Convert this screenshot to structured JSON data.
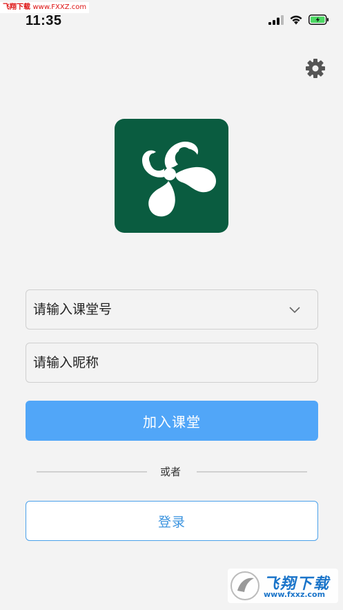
{
  "watermark_top": {
    "name": "飞翔下载",
    "url": "www.FXXZ.com"
  },
  "status_bar": {
    "time": "11:35",
    "signal_icon": "cellular-signal-icon",
    "wifi_icon": "wifi-icon",
    "battery_icon": "battery-charging-icon",
    "battery_color": "#4cd964"
  },
  "settings": {
    "icon": "gear-icon"
  },
  "logo": {
    "name": "app-logo",
    "bg_color": "#0a5c40"
  },
  "form": {
    "classroom_placeholder": "请输入课堂号",
    "classroom_value": "",
    "nickname_placeholder": "请输入昵称",
    "nickname_value": "",
    "join_label": "加入课堂",
    "or_label": "或者",
    "login_label": "登录"
  },
  "colors": {
    "primary": "#51a6f8",
    "login_border": "#4aa0ea",
    "background": "#f3f3f3"
  },
  "watermark_bottom": {
    "brand": "飞翔下载",
    "site": "www.fxxz.com"
  }
}
